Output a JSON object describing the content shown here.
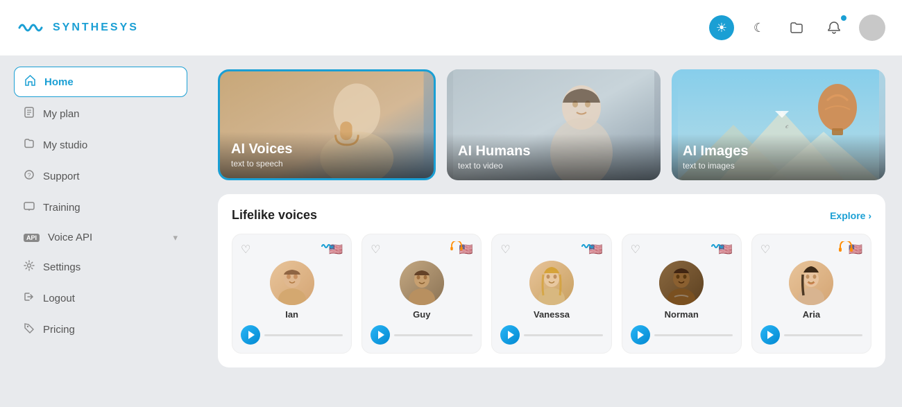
{
  "header": {
    "logo_text": "SYNTHESYS",
    "icons": {
      "theme_light": "☀",
      "theme_dark": "☾",
      "folder": "🗂",
      "bell": "🔔"
    }
  },
  "sidebar": {
    "items": [
      {
        "id": "home",
        "label": "Home",
        "icon": "⌂",
        "active": true
      },
      {
        "id": "my-plan",
        "label": "My plan",
        "icon": "📄"
      },
      {
        "id": "my-studio",
        "label": "My studio",
        "icon": "🗂"
      },
      {
        "id": "support",
        "label": "Support",
        "icon": "❓"
      },
      {
        "id": "training",
        "label": "Training",
        "icon": "🖥"
      },
      {
        "id": "voice-api",
        "label": "Voice API",
        "icon": "API",
        "hasChevron": true
      },
      {
        "id": "settings",
        "label": "Settings",
        "icon": "⚙"
      },
      {
        "id": "logout",
        "label": "Logout",
        "icon": "→"
      },
      {
        "id": "pricing",
        "label": "Pricing",
        "icon": "🏷"
      }
    ]
  },
  "feature_cards": [
    {
      "id": "ai-voices",
      "title": "AI Voices",
      "subtitle": "text to speech",
      "selected": true,
      "bg_class": "card-voices"
    },
    {
      "id": "ai-humans",
      "title": "AI Humans",
      "subtitle": "text to video",
      "selected": false,
      "bg_class": "card-humans"
    },
    {
      "id": "ai-images",
      "title": "AI Images",
      "subtitle": "text to images",
      "selected": false,
      "bg_class": "card-images"
    }
  ],
  "voices_section": {
    "title": "Lifelike voices",
    "explore_label": "Explore ›",
    "voices": [
      {
        "id": "ian",
        "name": "Ian",
        "avatar_class": "voice-avatar-ian",
        "initials": "",
        "badge": "wave",
        "flag": "🇺🇸"
      },
      {
        "id": "guy",
        "name": "Guy",
        "avatar_class": "voice-avatar-guy",
        "initials": "",
        "badge": "headphone",
        "flag": "🇺🇸"
      },
      {
        "id": "vanessa",
        "name": "Vanessa",
        "avatar_class": "voice-avatar-vanessa",
        "initials": "",
        "badge": "wave",
        "flag": "🇺🇸"
      },
      {
        "id": "norman",
        "name": "Norman",
        "avatar_class": "voice-avatar-norman",
        "initials": "",
        "badge": "wave",
        "flag": "🇺🇸"
      },
      {
        "id": "aria",
        "name": "Aria",
        "avatar_class": "voice-avatar-aria",
        "initials": "",
        "badge": "headphone",
        "flag": "🇺🇸"
      }
    ]
  }
}
